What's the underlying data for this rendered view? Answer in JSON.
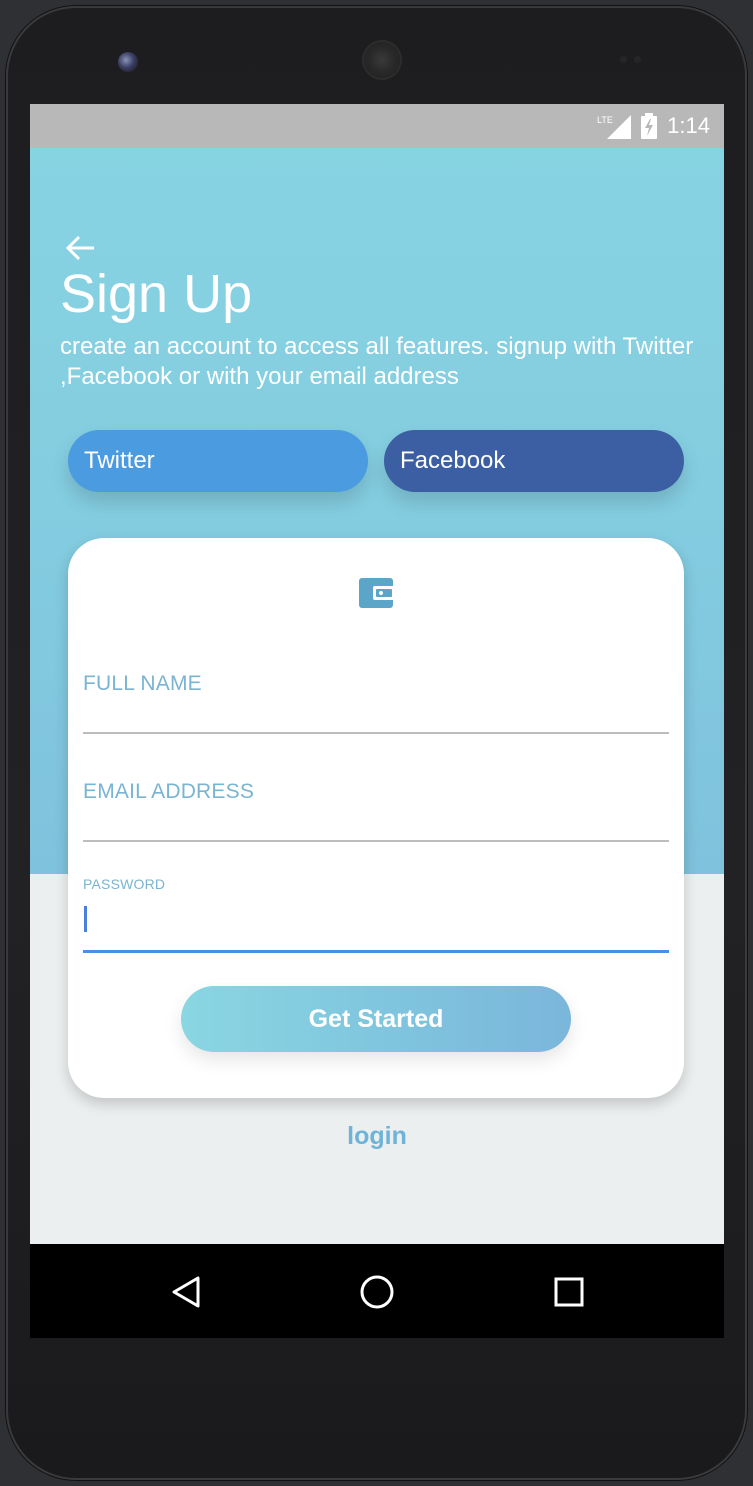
{
  "status_bar": {
    "network": "LTE",
    "time": "1:14"
  },
  "header": {
    "back_icon": "arrow-left-icon",
    "title": "Sign Up",
    "subtitle": "create an account to access all features. signup with Twitter ,Facebook or with your email address"
  },
  "social": {
    "twitter_label": "Twitter",
    "facebook_label": "Facebook"
  },
  "form": {
    "icon": "wallet-icon",
    "full_name": {
      "label": "FULL NAME",
      "value": ""
    },
    "email": {
      "label": "EMAIL ADDRESS",
      "value": ""
    },
    "password": {
      "label": "PASSWORD",
      "value": ""
    },
    "submit_label": "Get Started"
  },
  "login_label": "login",
  "nav": {
    "back_icon": "triangle-back-icon",
    "home_icon": "circle-home-icon",
    "recents_icon": "square-recents-icon"
  },
  "colors": {
    "hero": "#86d3e2",
    "twitter": "#4b9be0",
    "facebook": "#3c5fa4",
    "accent_label": "#7ab4d2",
    "focus_line": "#4a90e2"
  }
}
